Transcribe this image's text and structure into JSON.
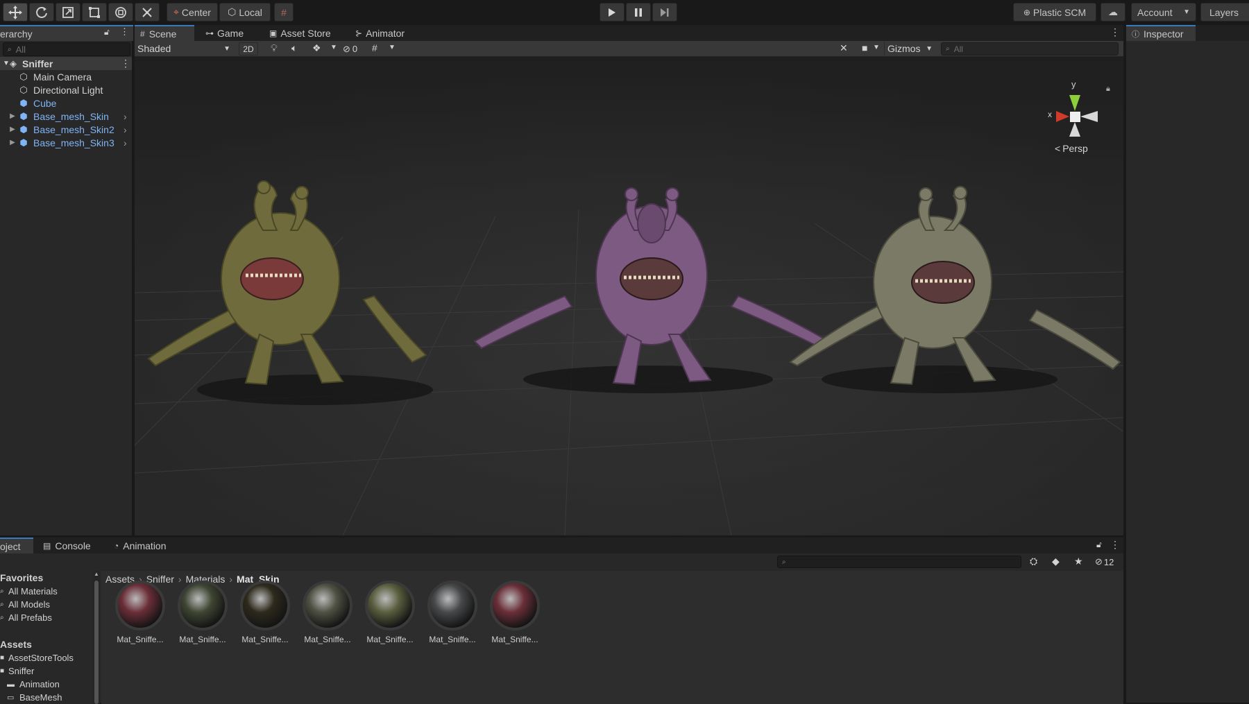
{
  "toolbar": {
    "tools": [
      "move-tool",
      "rotate-tool",
      "scale-tool",
      "rect-tool",
      "transform-tool",
      "custom-tool"
    ],
    "pivot_label": "Center",
    "space_label": "Local",
    "plastic_label": "Plastic SCM",
    "account_label": "Account",
    "layers_label": "Layers"
  },
  "hierarchy": {
    "tab_label": "erarchy",
    "search_placeholder": "All",
    "scene_name": "Sniffer",
    "items": [
      {
        "label": "Main Camera",
        "prefab": false
      },
      {
        "label": "Directional Light",
        "prefab": false
      },
      {
        "label": "Cube",
        "prefab": true
      },
      {
        "label": "Base_mesh_Skin",
        "prefab": true
      },
      {
        "label": "Base_mesh_Skin2",
        "prefab": true
      },
      {
        "label": "Base_mesh_Skin3",
        "prefab": true
      }
    ]
  },
  "scene": {
    "tabs": [
      "Scene",
      "Game",
      "Asset Store",
      "Animator"
    ],
    "shading_mode": "Shaded",
    "twod_label": "2D",
    "hidden_count": "0",
    "gizmos_label": "Gizmos",
    "search_placeholder": "All",
    "gizmo_y": "y",
    "gizmo_x": "x",
    "projection_label": "Persp"
  },
  "inspector": {
    "tab_label": "Inspector"
  },
  "project": {
    "tabs": [
      "oject",
      "Console",
      "Animation"
    ],
    "hidden_count": "12",
    "favorites_header": "Favorites",
    "favorites": [
      "All Materials",
      "All Models",
      "All Prefabs"
    ],
    "assets_header": "Assets",
    "assets": [
      "AssetStoreTools",
      "Sniffer",
      "Animation",
      "BaseMesh"
    ],
    "breadcrumb": [
      "Assets",
      "Sniffer",
      "Materials",
      "Mat_Skin"
    ],
    "materials": [
      {
        "label": "Mat_Sniffe...",
        "color": "#6a2e38"
      },
      {
        "label": "Mat_Sniffe...",
        "color": "#3f4633"
      },
      {
        "label": "Mat_Sniffe...",
        "color": "#2d2a1c"
      },
      {
        "label": "Mat_Sniffe...",
        "color": "#4e5142"
      },
      {
        "label": "Mat_Sniffe...",
        "color": "#5a5e3e"
      },
      {
        "label": "Mat_Sniffe...",
        "color": "#46484a"
      },
      {
        "label": "Mat_Sniffe...",
        "color": "#6a2e38"
      }
    ]
  },
  "colors": {
    "accent": "#3a79bb",
    "creature_olive": "#7b7b45",
    "creature_purple": "#8a5a8e",
    "creature_grey": "#8a8a74"
  }
}
